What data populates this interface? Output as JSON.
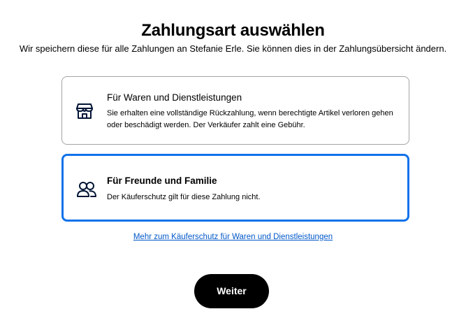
{
  "header": {
    "title": "Zahlungsart auswählen",
    "subtitle": "Wir speichern diese für alle Zahlungen an Stefanie Erle. Sie können dies in der Zahlungsübersicht ändern."
  },
  "options": [
    {
      "icon": "storefront-icon",
      "title": "Für Waren und Dienstleistungen",
      "description": "Sie erhalten eine vollständige Rückzahlung, wenn berechtigte Artikel verloren gehen oder beschädigt werden. Der Verkäufer zahlt eine Gebühr.",
      "selected": false
    },
    {
      "icon": "people-icon",
      "title": "Für Freunde und Familie",
      "description": "Der Käuferschutz gilt für diese Zahlung nicht.",
      "selected": true
    }
  ],
  "learn_more": {
    "label": "Mehr zum Käuferschutz für Waren und Dienstleistungen"
  },
  "continue_button": {
    "label": "Weiter"
  },
  "colors": {
    "selected_border": "#1072eb",
    "link": "#0057c9",
    "button_bg": "#000000",
    "button_text": "#ffffff",
    "unselected_border": "#a4a4a4"
  }
}
